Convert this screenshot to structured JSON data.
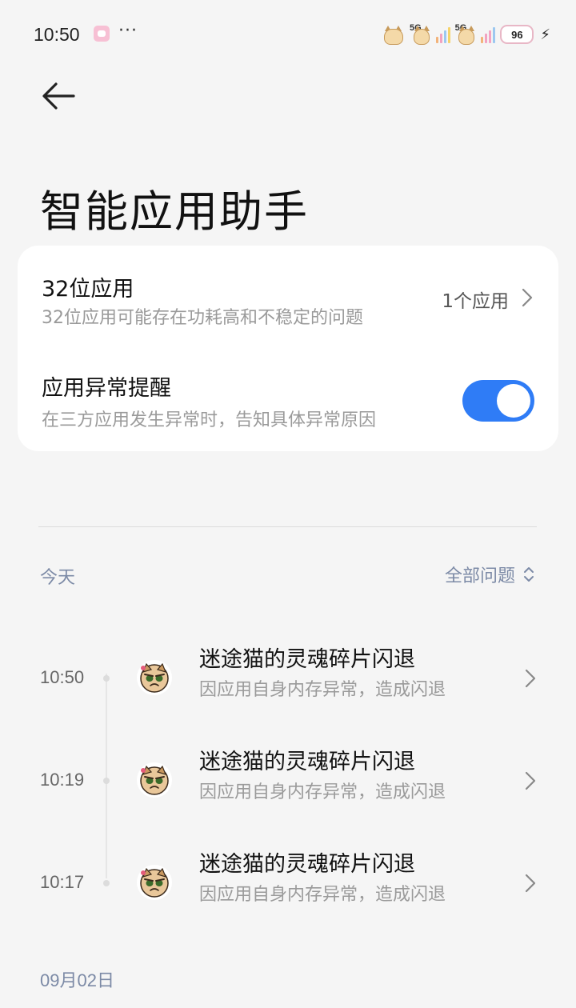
{
  "status_bar": {
    "time": "10:50",
    "notification_icon": "app-notification-icon",
    "more": "···",
    "network_1": "5G",
    "network_2": "5G",
    "battery": "96",
    "charging_icon": "bolt-icon"
  },
  "header": {
    "back_icon": "arrow-left-icon",
    "title": "智能应用助手"
  },
  "settings": {
    "row_32bit": {
      "title": "32位应用",
      "description": "32位应用可能存在功耗高和不稳定的问题",
      "value": "1个应用"
    },
    "row_alert": {
      "title": "应用异常提醒",
      "description": "在三方应用发生异常时，告知具体异常原因",
      "toggle_on": true
    }
  },
  "colors": {
    "accent": "#2f7cf6",
    "section_label": "#7c8aa6",
    "background": "#f5f5f5"
  },
  "crash_log": {
    "today_label": "今天",
    "filter_label": "全部问题",
    "items": [
      {
        "time": "10:50",
        "title": "迷途猫的灵魂碎片闪退",
        "description": "因应用自身内存异常，造成闪退"
      },
      {
        "time": "10:19",
        "title": "迷途猫的灵魂碎片闪退",
        "description": "因应用自身内存异常，造成闪退"
      },
      {
        "time": "10:17",
        "title": "迷途猫的灵魂碎片闪退",
        "description": "因应用自身内存异常，造成闪退"
      }
    ],
    "next_date_label": "09月02日"
  }
}
